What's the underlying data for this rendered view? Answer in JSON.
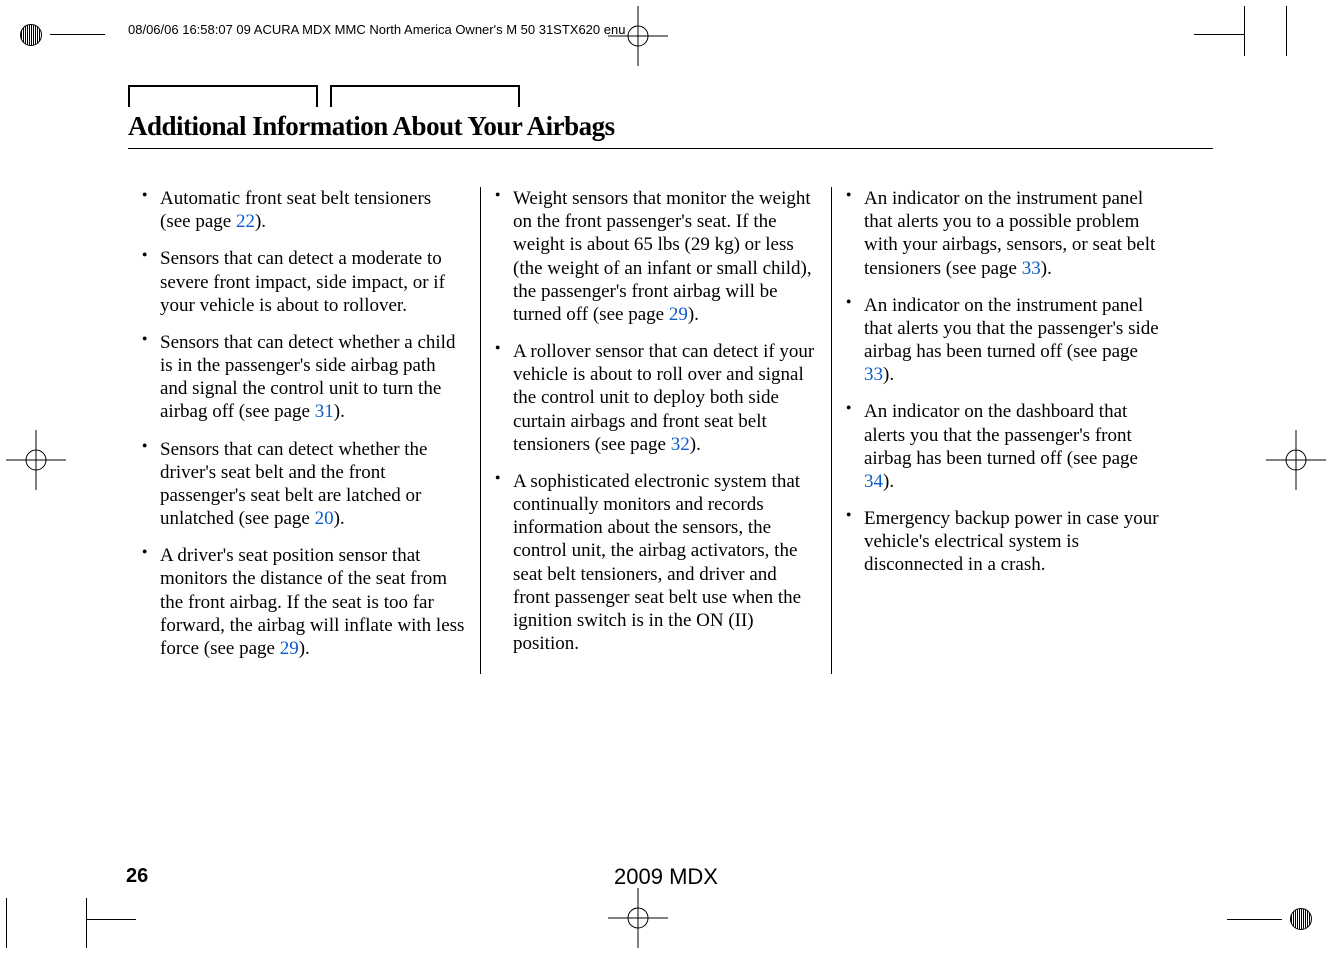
{
  "header_strip": "08/06/06 16:58:07   09 ACURA MDX MMC North America Owner's M 50 31STX620 enu",
  "title": "Additional Information About Your Airbags",
  "page_number": "26",
  "footer_model": "2009  MDX",
  "link_color": "#0b5bcc",
  "columns": {
    "c1": {
      "li1a": "Automatic front seat belt tensioners (see page ",
      "li1link": "22",
      "li1b": ").",
      "li2": "Sensors that can detect a moderate to severe front impact, side impact, or if your vehicle is about to rollover.",
      "li3a": "Sensors that can detect whether a child is in the passenger's side airbag path and signal the control unit to turn the airbag off (see page ",
      "li3link": "31",
      "li3b": ").",
      "li4a": "Sensors that can detect whether the driver's seat belt and the front passenger's seat belt are latched or unlatched (see page ",
      "li4link": "20",
      "li4b": ").",
      "li5a": "A driver's seat position sensor that monitors the distance of the seat from the front airbag. If the seat is too far forward, the airbag will inflate with less force (see page ",
      "li5link": "29",
      "li5b": ")."
    },
    "c2": {
      "li1a": "Weight sensors that monitor the weight on the front passenger's seat. If the weight is about 65 lbs (29 kg) or less (the weight of an infant or small child), the passenger's front airbag will be turned off (see page ",
      "li1link": "29",
      "li1b": ").",
      "li2a": "A rollover sensor that can detect if your vehicle is about to roll over and signal the control unit to deploy both side curtain airbags and front seat belt tensioners (see page ",
      "li2link": "32",
      "li2b": ").",
      "li3": "A sophisticated electronic system that continually monitors and records information about the sensors, the control unit, the airbag activators, the seat belt tensioners, and driver and front passenger seat belt use when the ignition switch is in the ON (II) position."
    },
    "c3": {
      "li1a": "An indicator on the instrument panel that alerts you to a possible problem with your airbags, sensors, or seat belt tensioners (see page ",
      "li1link": "33",
      "li1b": ").",
      "li2a": "An indicator on the instrument panel that alerts you that the passenger's side airbag has been turned off (see page ",
      "li2link": "33",
      "li2b": ").",
      "li3a": "An indicator on the dashboard that alerts you that the passenger's front airbag has been turned off (see page ",
      "li3link": "34",
      "li3b": ").",
      "li4": "Emergency backup power in case your vehicle's electrical system is disconnected in a crash."
    }
  }
}
